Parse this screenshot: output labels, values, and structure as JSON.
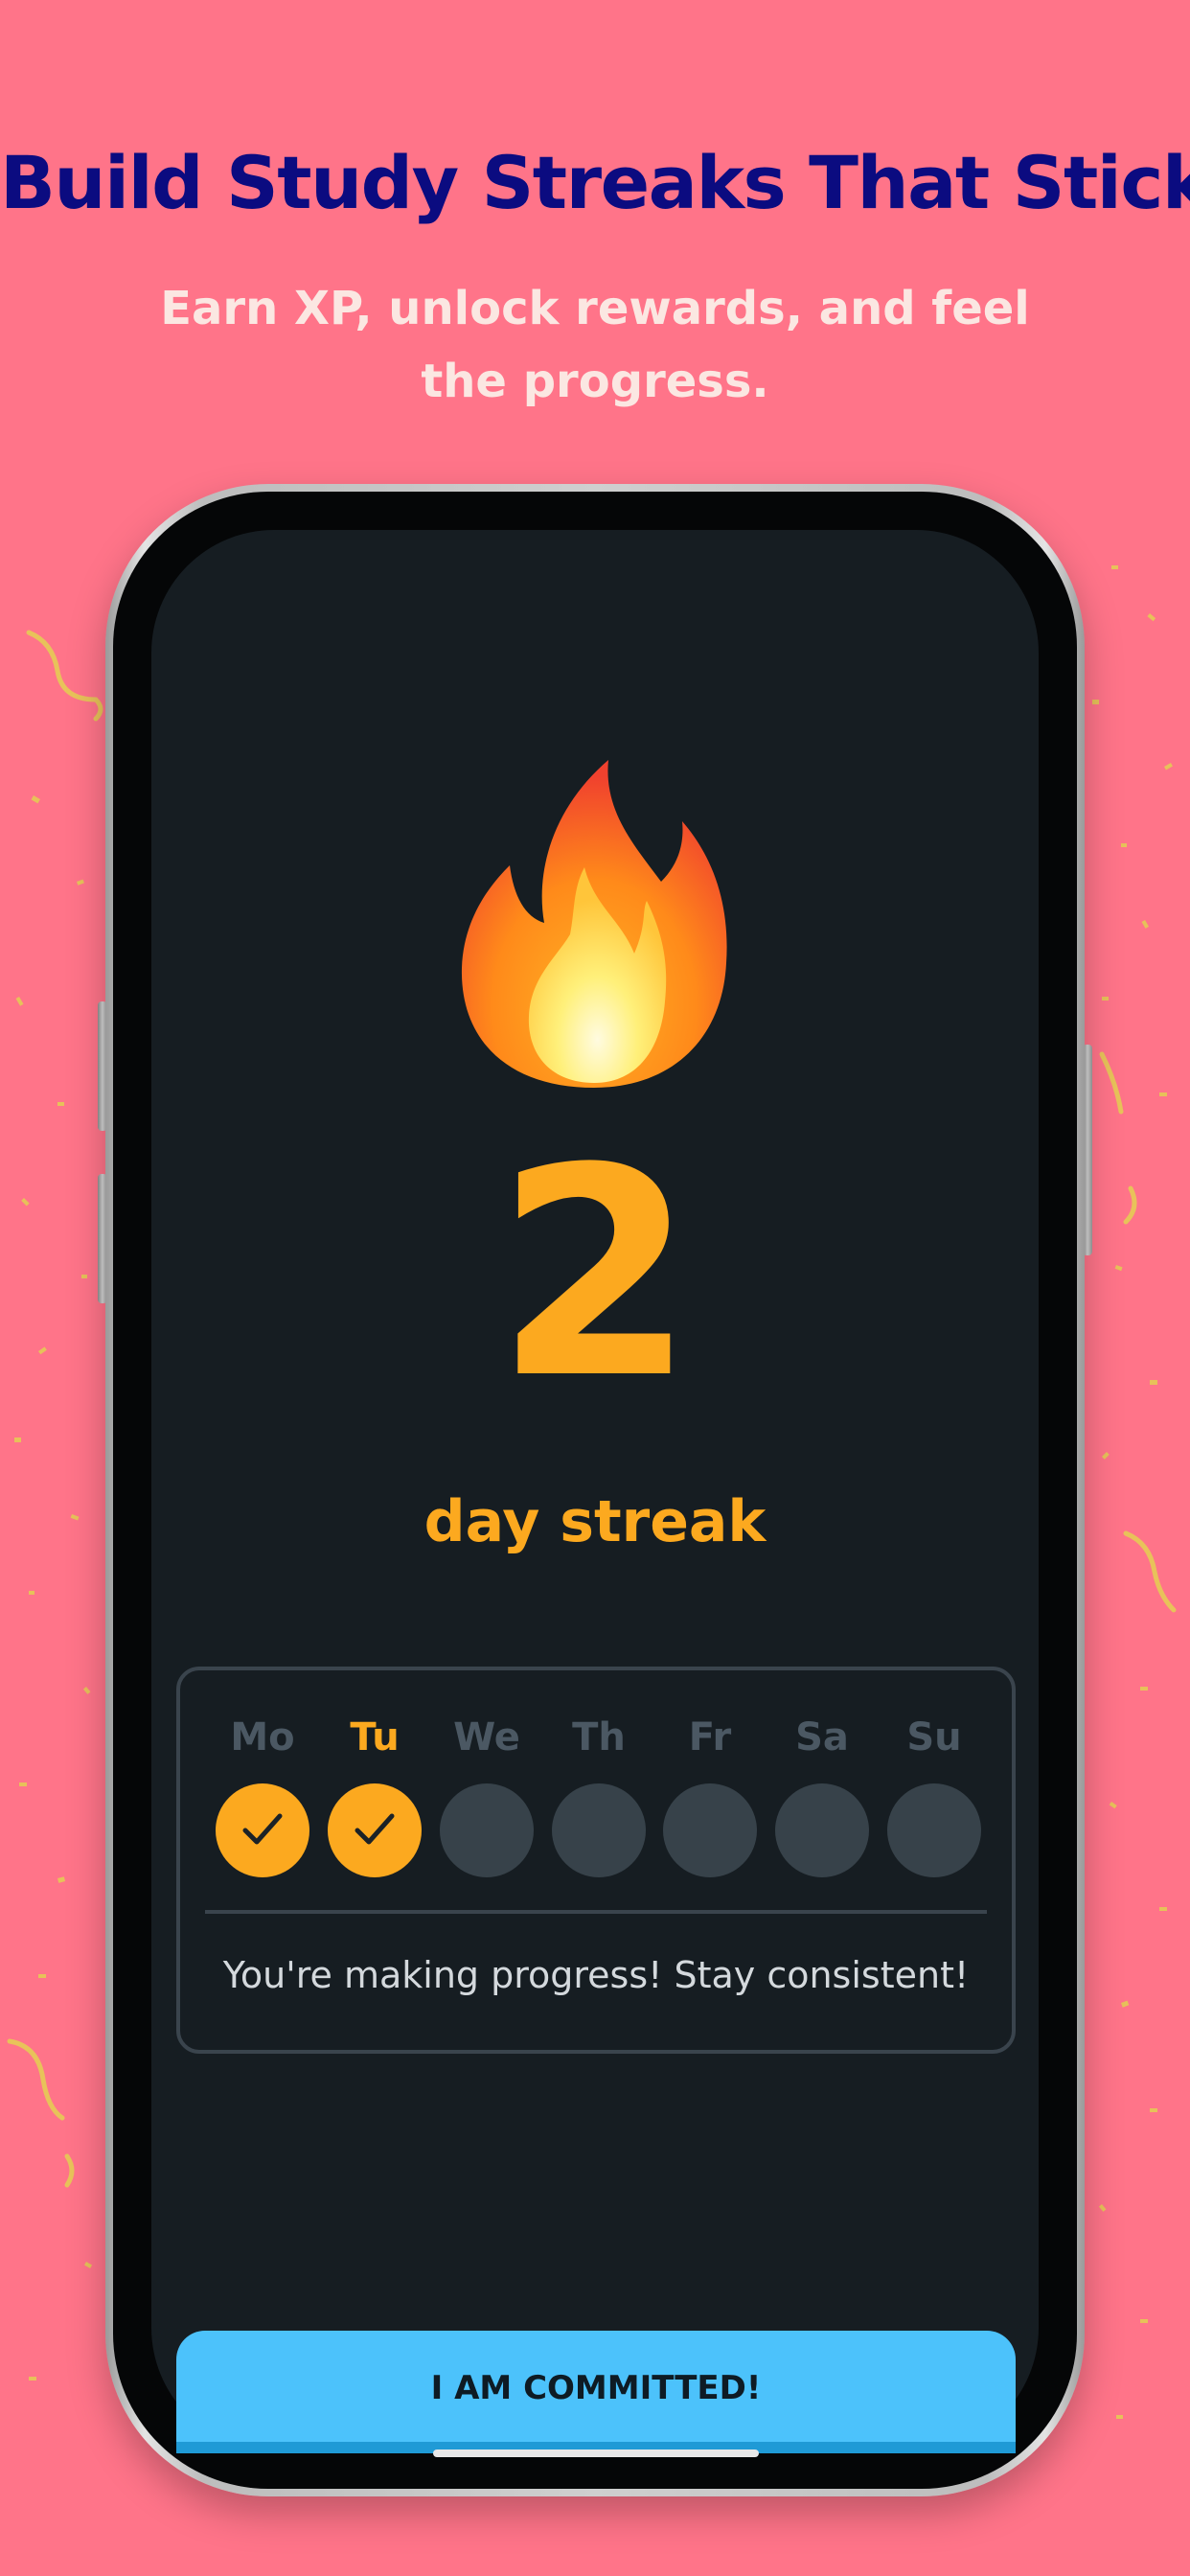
{
  "header": {
    "title": "Build Study Streaks That Stick",
    "subtitle": "Earn XP, unlock rewards, and feel the progress."
  },
  "streak": {
    "icon": "fire-icon",
    "count": "2",
    "label": "day streak"
  },
  "week": {
    "days": [
      {
        "label": "Mo",
        "completed": true,
        "today": false
      },
      {
        "label": "Tu",
        "completed": true,
        "today": true
      },
      {
        "label": "We",
        "completed": false,
        "today": false
      },
      {
        "label": "Th",
        "completed": false,
        "today": false
      },
      {
        "label": "Fr",
        "completed": false,
        "today": false
      },
      {
        "label": "Sa",
        "completed": false,
        "today": false
      },
      {
        "label": "Su",
        "completed": false,
        "today": false
      }
    ],
    "message": "You're making progress! Stay consistent!"
  },
  "actions": {
    "commit_label": "I AM COMMITTED!"
  },
  "colors": {
    "background": "#ff7489",
    "headline": "#0b0b80",
    "accent": "#fca91f",
    "screen": "#161d22",
    "button": "#4cc2fb"
  }
}
